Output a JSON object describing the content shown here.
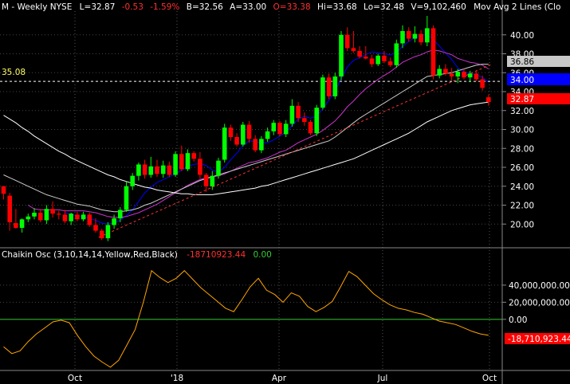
{
  "header": {
    "symbol": "M - Weekly  NYSE",
    "last": "L=32.87",
    "change": "-0.53",
    "change_pct": "-1.59%",
    "bid": "B=32.56",
    "ask": "A=33.00",
    "open": "O=33.38",
    "high": "Hi=33.68",
    "low": "Lo=32.48",
    "volume": "V=9,102,460",
    "ma_label": "Mov Avg 2 Lines (Clo"
  },
  "colors": {
    "background": "#000000",
    "up": "#00ff00",
    "down": "#ff0000",
    "ma_fast": "#0000ff",
    "ma_mid": "#cc33cc",
    "ma_slow1": "#cccccc",
    "ma_slow2": "#ffffff",
    "trend": "#ff3030",
    "osc": "#ffa500",
    "zero": "#33cc33"
  },
  "price_panel": {
    "y_ticks": [
      "20.00",
      "22.00",
      "24.00",
      "26.00",
      "28.00",
      "30.00",
      "32.00",
      "34.00",
      "36.00",
      "38.00",
      "40.00"
    ],
    "reference_line_label": "35.08",
    "value_tags": [
      "36.86",
      "34.00",
      "32.87"
    ]
  },
  "osc_panel": {
    "title": "Chaikin Osc (3,10,14,14,Yellow,Red,Black)",
    "value_red": "-18710923.44",
    "value_green": "0.00",
    "y_ticks": [
      "40,000,000.00",
      "20,000,000.00",
      "0.00"
    ],
    "value_tag": "-18,710,923.44"
  },
  "x_ticks": [
    "Oct",
    "'18",
    "Apr",
    "Jul",
    "Oct"
  ],
  "chart_data": {
    "type": "candlestick",
    "x_labels": [
      "Oct",
      "'18",
      "Apr",
      "Jul",
      "Oct"
    ],
    "ylim": [
      18,
      42
    ],
    "reference_line": 35.08,
    "candles": [
      [
        24.0,
        24.0,
        22.6,
        23.2
      ],
      [
        23.0,
        23.3,
        19.3,
        20.2
      ],
      [
        20.1,
        21.6,
        19.5,
        19.6
      ],
      [
        19.6,
        20.6,
        19.1,
        20.5
      ],
      [
        20.5,
        21.1,
        20.2,
        20.8
      ],
      [
        20.8,
        21.7,
        20.5,
        21.2
      ],
      [
        21.2,
        21.6,
        20.2,
        20.4
      ],
      [
        20.4,
        22.0,
        20.0,
        21.6
      ],
      [
        21.6,
        22.4,
        20.7,
        21.1
      ],
      [
        21.1,
        21.4,
        20.5,
        21.0
      ],
      [
        21.0,
        21.5,
        20.1,
        20.3
      ],
      [
        20.3,
        21.2,
        19.9,
        21.1
      ],
      [
        21.0,
        21.3,
        20.3,
        20.5
      ],
      [
        20.5,
        21.3,
        20.3,
        21.0
      ],
      [
        21.0,
        21.2,
        19.7,
        19.9
      ],
      [
        19.9,
        20.6,
        19.1,
        19.3
      ],
      [
        19.3,
        19.5,
        18.3,
        18.5
      ],
      [
        18.5,
        20.2,
        18.2,
        19.9
      ],
      [
        19.9,
        21.0,
        19.5,
        20.6
      ],
      [
        20.6,
        21.8,
        20.2,
        21.5
      ],
      [
        21.5,
        24.5,
        21.3,
        24.0
      ],
      [
        24.0,
        25.4,
        23.6,
        25.1
      ],
      [
        25.1,
        26.5,
        24.6,
        26.3
      ],
      [
        26.3,
        26.8,
        24.8,
        25.2
      ],
      [
        25.2,
        27.1,
        24.9,
        26.1
      ],
      [
        26.1,
        26.8,
        25.0,
        25.3
      ],
      [
        25.3,
        26.7,
        24.9,
        26.2
      ],
      [
        26.2,
        26.6,
        25.0,
        25.2
      ],
      [
        25.2,
        27.7,
        25.0,
        27.4
      ],
      [
        27.4,
        28.3,
        25.6,
        25.8
      ],
      [
        25.8,
        27.9,
        25.6,
        27.5
      ],
      [
        27.5,
        27.7,
        26.6,
        26.9
      ],
      [
        26.9,
        27.6,
        24.8,
        25.2
      ],
      [
        25.2,
        25.4,
        23.4,
        24.0
      ],
      [
        24.0,
        25.6,
        23.6,
        25.1
      ],
      [
        25.1,
        27.0,
        24.8,
        26.7
      ],
      [
        26.8,
        30.6,
        26.5,
        30.2
      ],
      [
        30.2,
        30.5,
        28.8,
        29.2
      ],
      [
        29.2,
        29.6,
        28.2,
        28.4
      ],
      [
        28.4,
        30.8,
        28.2,
        30.5
      ],
      [
        30.5,
        30.9,
        28.6,
        29.0
      ],
      [
        29.0,
        29.4,
        27.6,
        27.8
      ],
      [
        27.8,
        29.3,
        27.5,
        29.0
      ],
      [
        29.0,
        30.2,
        28.7,
        29.8
      ],
      [
        29.8,
        31.0,
        29.4,
        30.7
      ],
      [
        30.7,
        30.9,
        29.3,
        29.5
      ],
      [
        29.5,
        31.0,
        29.2,
        30.6
      ],
      [
        30.6,
        33.2,
        30.3,
        32.5
      ],
      [
        32.5,
        32.9,
        30.8,
        31.2
      ],
      [
        31.2,
        31.8,
        30.4,
        30.8
      ],
      [
        30.8,
        31.0,
        29.4,
        29.6
      ],
      [
        29.6,
        32.6,
        29.3,
        32.3
      ],
      [
        32.3,
        35.8,
        32.1,
        35.5
      ],
      [
        35.5,
        35.9,
        33.2,
        33.5
      ],
      [
        33.5,
        36.0,
        33.2,
        35.6
      ],
      [
        35.6,
        40.4,
        35.2,
        40.0
      ],
      [
        40.0,
        40.8,
        38.3,
        38.6
      ],
      [
        38.6,
        40.4,
        38.1,
        38.3
      ],
      [
        38.3,
        38.8,
        37.5,
        37.7
      ],
      [
        37.7,
        38.8,
        37.4,
        37.5
      ],
      [
        37.5,
        37.9,
        36.6,
        36.9
      ],
      [
        36.9,
        38.0,
        36.7,
        37.8
      ],
      [
        37.8,
        38.3,
        37.0,
        37.2
      ],
      [
        37.2,
        37.6,
        36.6,
        36.8
      ],
      [
        36.8,
        39.5,
        36.5,
        39.1
      ],
      [
        39.1,
        41.0,
        38.6,
        40.4
      ],
      [
        40.4,
        40.8,
        39.3,
        39.6
      ],
      [
        39.6,
        40.9,
        39.2,
        40.1
      ],
      [
        40.1,
        40.5,
        38.9,
        39.2
      ],
      [
        39.2,
        42.0,
        38.8,
        40.7
      ],
      [
        40.7,
        41.0,
        35.3,
        35.7
      ],
      [
        35.7,
        36.8,
        35.4,
        36.4
      ],
      [
        36.4,
        36.9,
        35.7,
        35.9
      ],
      [
        35.9,
        36.5,
        35.2,
        35.6
      ],
      [
        35.6,
        36.4,
        34.9,
        36.1
      ],
      [
        36.1,
        36.4,
        35.3,
        35.5
      ],
      [
        35.5,
        36.2,
        35.0,
        35.9
      ],
      [
        35.9,
        36.3,
        35.1,
        35.3
      ],
      [
        35.3,
        35.7,
        34.1,
        34.4
      ],
      [
        33.4,
        33.7,
        32.5,
        32.9
      ]
    ],
    "series": [
      {
        "values": [
          null,
          null,
          null,
          null,
          null,
          null,
          null,
          null,
          null,
          null,
          21.2,
          21.0,
          20.9,
          20.8,
          20.6,
          20.4,
          20.1,
          20.0,
          20.1,
          20.4,
          20.9,
          21.5,
          22.4,
          23.3,
          23.9,
          24.4,
          24.7,
          25.0,
          25.3,
          25.7,
          26.1,
          26.3,
          26.4,
          26.2,
          25.7,
          25.5,
          26.0,
          26.8,
          27.5,
          28.3,
          28.8,
          28.7,
          28.6,
          28.6,
          28.9,
          29.3,
          29.7,
          30.4,
          31.1,
          31.4,
          31.2,
          31.4,
          32.2,
          33.1,
          34.0,
          35.4,
          36.6,
          37.3,
          37.6,
          37.9,
          38.2,
          38.1,
          38.0,
          37.9,
          38.1,
          38.8,
          39.3,
          39.7,
          39.9,
          40.1,
          39.5,
          38.8,
          38.1,
          37.4,
          36.5,
          36.1,
          35.9,
          35.8,
          35.5,
          35.0
        ]
      },
      {
        "values": [
          null,
          null,
          null,
          null,
          22.0,
          21.6,
          21.5,
          21.5,
          21.5,
          21.5,
          21.4,
          21.4,
          21.4,
          21.4,
          21.3,
          21.2,
          21.0,
          20.8,
          20.7,
          20.7,
          20.8,
          21.0,
          21.2,
          21.5,
          21.8,
          22.1,
          22.5,
          22.9,
          23.3,
          23.7,
          24.1,
          24.4,
          24.7,
          24.9,
          25.0,
          25.1,
          25.3,
          25.6,
          25.9,
          26.2,
          26.5,
          26.6,
          26.8,
          27.0,
          27.3,
          27.6,
          27.8,
          28.2,
          28.6,
          28.9,
          29.2,
          29.5,
          29.9,
          30.4,
          30.9,
          31.6,
          32.4,
          33.0,
          33.7,
          34.3,
          34.8,
          35.3,
          35.7,
          36.1,
          36.6,
          37.1,
          37.4,
          37.7,
          37.9,
          38.2,
          38.4,
          38.3,
          38.1,
          37.9,
          37.5,
          37.3,
          37.1,
          37.0,
          36.8,
          36.4
        ]
      },
      {
        "values": [
          25.2,
          24.9,
          24.6,
          24.3,
          24.0,
          23.7,
          23.4,
          23.1,
          22.9,
          22.7,
          22.5,
          22.3,
          22.1,
          22.0,
          21.9,
          21.7,
          21.5,
          21.4,
          21.3,
          21.3,
          21.4,
          21.5,
          21.7,
          22.0,
          22.2,
          22.5,
          22.8,
          23.1,
          23.4,
          23.7,
          24.0,
          24.3,
          24.6,
          24.8,
          25.0,
          25.2,
          25.4,
          25.6,
          25.8,
          26.0,
          26.2,
          26.4,
          26.6,
          26.8,
          27.0,
          27.2,
          27.4,
          27.6,
          27.8,
          28.0,
          28.2,
          28.4,
          28.6,
          28.8,
          29.2,
          29.7,
          30.2,
          30.7,
          31.2,
          31.6,
          32.0,
          32.4,
          32.8,
          33.2,
          33.6,
          34.0,
          34.4,
          34.8,
          35.2,
          35.6,
          35.7,
          35.8,
          35.9,
          36.0,
          36.2,
          36.4,
          36.6,
          36.8,
          36.9,
          36.9
        ]
      },
      {
        "values": [
          31.5,
          31.1,
          30.7,
          30.2,
          29.8,
          29.3,
          28.9,
          28.5,
          28.1,
          27.7,
          27.4,
          27.0,
          26.7,
          26.4,
          26.1,
          25.8,
          25.5,
          25.2,
          25.0,
          24.7,
          24.5,
          24.3,
          24.1,
          23.9,
          23.8,
          23.6,
          23.5,
          23.4,
          23.3,
          23.2,
          23.2,
          23.1,
          23.1,
          23.1,
          23.1,
          23.2,
          23.3,
          23.4,
          23.5,
          23.6,
          23.7,
          23.8,
          24.0,
          24.1,
          24.3,
          24.5,
          24.7,
          24.9,
          25.1,
          25.3,
          25.5,
          25.7,
          25.9,
          26.1,
          26.3,
          26.5,
          26.7,
          26.9,
          27.2,
          27.5,
          27.8,
          28.1,
          28.4,
          28.7,
          29.0,
          29.3,
          29.6,
          30.0,
          30.4,
          30.8,
          31.1,
          31.4,
          31.7,
          32.0,
          32.2,
          32.4,
          32.6,
          32.7,
          32.8,
          32.9
        ]
      }
    ],
    "trend_line": {
      "x": [
        15.5,
        79.5
      ],
      "y": [
        18.6,
        36.9
      ]
    },
    "oscillator": {
      "ylim": [
        -57000000,
        66000000
      ],
      "values": [
        -32000000,
        -40000000,
        -37000000,
        -26000000,
        -17000000,
        -10000000,
        -3000000,
        -1000000,
        -4000000,
        -19000000,
        -32000000,
        -43000000,
        -50000000,
        -56000000,
        -48000000,
        -30000000,
        -12000000,
        20000000,
        57000000,
        49000000,
        43000000,
        48000000,
        57000000,
        47000000,
        37000000,
        29000000,
        21000000,
        13000000,
        9000000,
        23000000,
        38000000,
        48000000,
        34000000,
        29000000,
        20000000,
        31000000,
        27000000,
        15000000,
        9000000,
        14000000,
        21000000,
        38000000,
        56000000,
        50000000,
        40000000,
        30000000,
        23000000,
        17000000,
        13000000,
        11000000,
        8000000,
        6000000,
        2000000,
        -2000000,
        -4000000,
        -6000000,
        -10000000,
        -14000000,
        -17000000,
        -18710923
      ]
    }
  }
}
